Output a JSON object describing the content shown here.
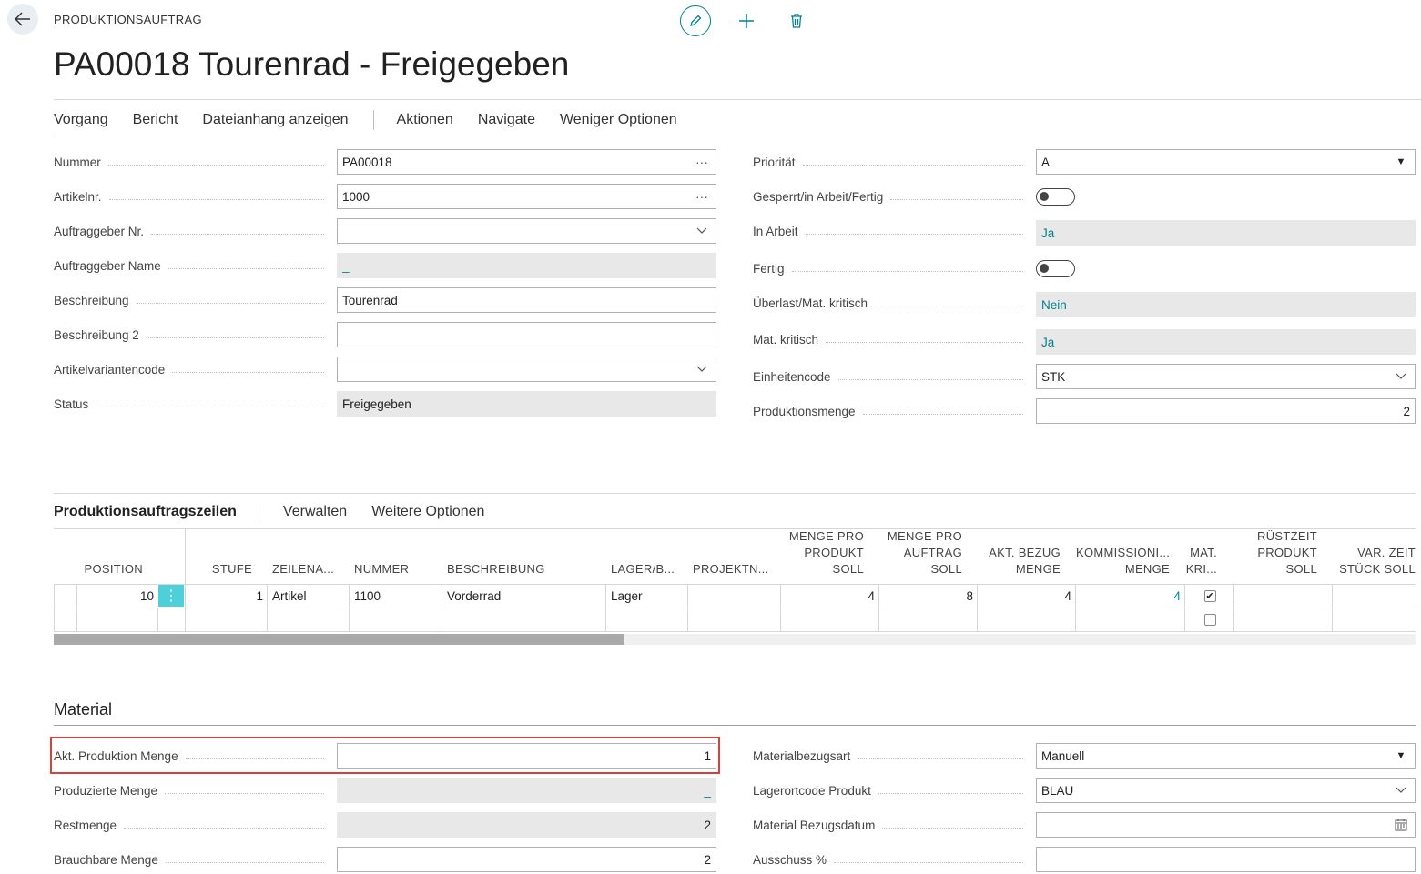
{
  "header": {
    "breadcrumb": "PRODUKTIONSAUFTRAG",
    "title": "PA00018 Tourenrad - Freigegeben"
  },
  "actionbar": {
    "vorgang": "Vorgang",
    "bericht": "Bericht",
    "dateianhang": "Dateianhang anzeigen",
    "aktionen": "Aktionen",
    "navigate": "Navigate",
    "weniger": "Weniger Optionen"
  },
  "general": {
    "nummer": {
      "label": "Nummer",
      "value": "PA00018"
    },
    "artikelnr": {
      "label": "Artikelnr.",
      "value": "1000"
    },
    "auftraggeber_nr": {
      "label": "Auftraggeber Nr.",
      "value": ""
    },
    "auftraggeber_name": {
      "label": "Auftraggeber Name",
      "value": "_"
    },
    "beschreibung": {
      "label": "Beschreibung",
      "value": "Tourenrad"
    },
    "beschreibung2": {
      "label": "Beschreibung 2",
      "value": ""
    },
    "artikelvariantencode": {
      "label": "Artikelvariantencode",
      "value": ""
    },
    "status": {
      "label": "Status",
      "value": "Freigegeben"
    },
    "prioritaet": {
      "label": "Priorität",
      "value": "A"
    },
    "gesperrt": {
      "label": "Gesperrt/in Arbeit/Fertig",
      "value": false
    },
    "in_arbeit": {
      "label": "In Arbeit",
      "value": "Ja"
    },
    "fertig": {
      "label": "Fertig",
      "value": false
    },
    "ueberlast": {
      "label": "Überlast/Mat. kritisch",
      "value": "Nein"
    },
    "mat_kritisch": {
      "label": "Mat. kritisch",
      "value": "Ja"
    },
    "einheitencode": {
      "label": "Einheitencode",
      "value": "STK"
    },
    "produktionsmenge": {
      "label": "Produktionsmenge",
      "value": "2"
    }
  },
  "lines": {
    "title": "Produktionsauftragszeilen",
    "verwalten": "Verwalten",
    "weitere": "Weitere Optionen",
    "headers": {
      "position": "POSITION",
      "stufe": "STUFE",
      "zeilenart": "ZEILENA...",
      "nummer": "NUMMER",
      "beschreibung": "BESCHREIBUNG",
      "lager": "LAGER/B...",
      "projekt": "PROJEKTN...",
      "menge_pro_produkt": [
        "MENGE PRO",
        "PRODUKT",
        "SOLL"
      ],
      "menge_pro_auftrag": [
        "MENGE PRO",
        "AUFTRAG",
        "SOLL"
      ],
      "akt_bezug": [
        "AKT. BEZUG",
        "MENGE"
      ],
      "kommissioniert": [
        "KOMMISSIONI...",
        "MENGE"
      ],
      "mat_kri": [
        "MAT.",
        "KRI..."
      ],
      "ruestzeit": [
        "RÜSTZEIT",
        "PRODUKT",
        "SOLL"
      ],
      "var_zeit": [
        "VAR. ZEIT",
        "STÜCK SOLL"
      ]
    },
    "rows": [
      {
        "position": "10",
        "stufe": "1",
        "zeilenart": "Artikel",
        "nummer": "1100",
        "beschreibung": "Vorderrad",
        "lager": "Lager",
        "projekt": "",
        "menge_pro_produkt": "4",
        "menge_pro_auftrag": "8",
        "akt_bezug": "4",
        "kommissioniert": "4",
        "mat_kri": true,
        "ruestzeit": "",
        "var_zeit": ""
      },
      {
        "position": "",
        "stufe": "",
        "zeilenart": "",
        "nummer": "",
        "beschreibung": "",
        "lager": "",
        "projekt": "",
        "menge_pro_produkt": "",
        "menge_pro_auftrag": "",
        "akt_bezug": "",
        "kommissioniert": "",
        "mat_kri": false,
        "ruestzeit": "",
        "var_zeit": ""
      }
    ]
  },
  "material": {
    "title": "Material",
    "akt_produktion_menge": {
      "label": "Akt. Produktion Menge",
      "value": "1"
    },
    "produzierte_menge": {
      "label": "Produzierte Menge",
      "value": "_"
    },
    "restmenge": {
      "label": "Restmenge",
      "value": "2"
    },
    "brauchbare_menge": {
      "label": "Brauchbare Menge",
      "value": "2"
    },
    "materialbezugsart": {
      "label": "Materialbezugsart",
      "value": "Manuell"
    },
    "lagerortcode_produkt": {
      "label": "Lagerortcode Produkt",
      "value": "BLAU"
    },
    "material_bezugsdatum": {
      "label": "Material Bezugsdatum",
      "value": ""
    },
    "ausschuss": {
      "label": "Ausschuss %",
      "value": ""
    }
  },
  "colors": {
    "accent": "#00838f",
    "highlight": "#d9403a",
    "row_menu": "#4dd0d9"
  }
}
